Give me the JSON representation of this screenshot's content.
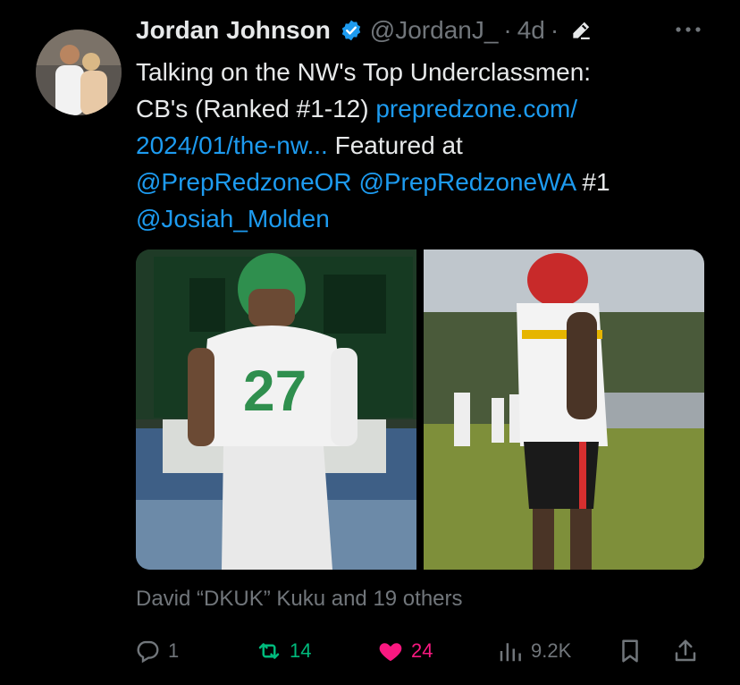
{
  "author": {
    "display_name": "Jordan Johnson",
    "handle": "@JordanJ_",
    "separator1": "·",
    "time": "4d",
    "separator2": "·",
    "verified_color": "#1d9bf0"
  },
  "menu": {
    "more_icon": "more-horizontal-icon"
  },
  "tweet": {
    "text_line1": "Talking on the NW's Top Underclassmen:",
    "text_line2_plain": "CB's (Ranked #1-12) ",
    "link_part1": "prepredzone.com/",
    "link_part2": "2024/01/the-nw...",
    "featured_at": " Featured at",
    "mention1": "@PrepRedzoneOR",
    "mention2": "@PrepRedzoneWA",
    "rank_label": " #1",
    "mention3": "@Josiah_Molden"
  },
  "media": [
    {
      "icon": "photo-icon",
      "description_color": "#2f8f4e"
    },
    {
      "icon": "photo-icon",
      "description_color": "#d62f2f"
    }
  ],
  "likers": "David “DKUK” Kuku and 19 others",
  "actions": {
    "reply_count": "1",
    "retweet_count": "14",
    "like_count": "24",
    "views_count": "9.2K"
  },
  "colors": {
    "accent": "#1d9bf0",
    "retweet_active": "#00ba7c",
    "like_active": "#f91880",
    "muted": "#71767b"
  }
}
